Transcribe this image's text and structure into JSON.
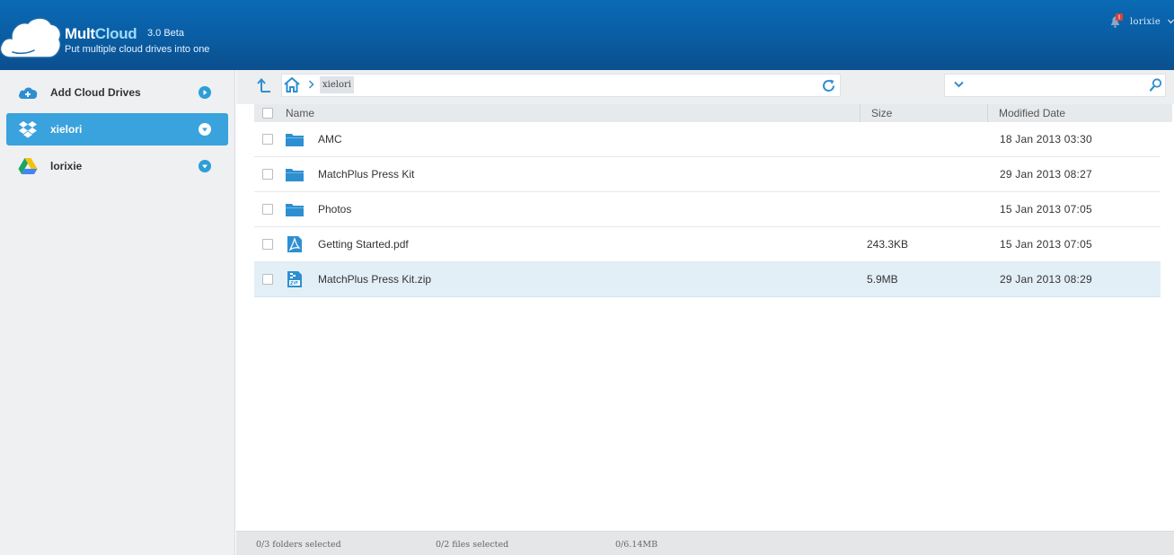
{
  "header": {
    "brand_part1": "Mult",
    "brand_part2": "Cloud",
    "version": "3.0 Beta",
    "tagline": "Put multiple cloud drives into one",
    "username": "lorixie",
    "notification_badge": "!"
  },
  "sidebar": {
    "items": [
      {
        "label": "Add Cloud Drives",
        "icon": "add-cloud-icon",
        "active": false
      },
      {
        "label": "xielori",
        "icon": "dropbox-icon",
        "active": true
      },
      {
        "label": "lorixie",
        "icon": "google-drive-icon",
        "active": false
      }
    ]
  },
  "toolbar": {
    "breadcrumb": "xielori",
    "search_placeholder": ""
  },
  "table": {
    "columns": {
      "name": "Name",
      "size": "Size",
      "modified": "Modified Date"
    },
    "rows": [
      {
        "name": "AMC",
        "type": "folder",
        "size": "",
        "modified": "18 Jan 2013 03:30"
      },
      {
        "name": "MatchPlus Press Kit",
        "type": "folder",
        "size": "",
        "modified": "29 Jan 2013 08:27"
      },
      {
        "name": "Photos",
        "type": "folder",
        "size": "",
        "modified": "15 Jan 2013 07:05"
      },
      {
        "name": "Getting Started.pdf",
        "type": "pdf",
        "size": "243.3KB",
        "modified": "15 Jan 2013 07:05"
      },
      {
        "name": "MatchPlus Press Kit.zip",
        "type": "zip",
        "size": "5.9MB",
        "modified": "29 Jan 2013 08:29"
      }
    ]
  },
  "status": {
    "folders": "0/3 folders selected",
    "files": "0/2 files selected",
    "size": "0/6.14MB"
  },
  "colors": {
    "header": "#0a5fa6",
    "accent": "#3aa2dd",
    "icon_blue": "#2e8fd0",
    "selected_row": "#e3eff7"
  }
}
